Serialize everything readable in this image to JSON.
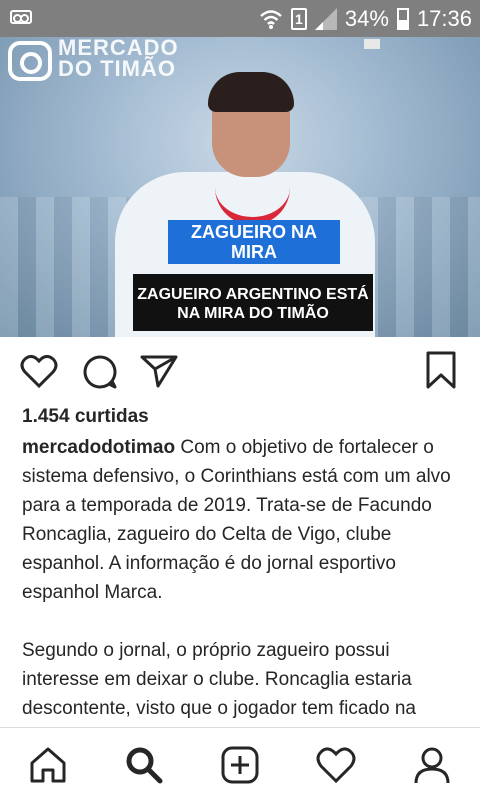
{
  "status_bar": {
    "battery": "34%",
    "time": "17:36",
    "sim": "1"
  },
  "post": {
    "image_logo_text": "MERCADO\nDO TIMÃO",
    "tag_blue": "ZAGUEIRO NA MIRA",
    "tag_black": "ZAGUEIRO ARGENTINO ESTÁ NA MIRA DO TIMÃO",
    "likes": "1.454 curtidas",
    "username": "mercadodotimao",
    "caption_p1": "Com o objetivo de fortalecer o sistema defensivo, o Corinthians está com um alvo para a temporada de 2019. Trata-se de Facundo Roncaglia, zagueiro do Celta de Vigo, clube espanhol. A informação é do jornal esportivo espanhol Marca.",
    "caption_p2": "Segundo o jornal, o próprio zagueiro possui interesse em deixar o clube. Roncaglia estaria descontente, visto que o jogador tem ficado na reserva do clube treinado por Miguel Cardoso,"
  },
  "icons": {
    "actions": [
      "heart-icon",
      "comment-icon",
      "share-icon",
      "bookmark-icon"
    ],
    "nav": [
      "home-icon",
      "search-icon",
      "add-icon",
      "activity-icon",
      "profile-icon"
    ]
  }
}
